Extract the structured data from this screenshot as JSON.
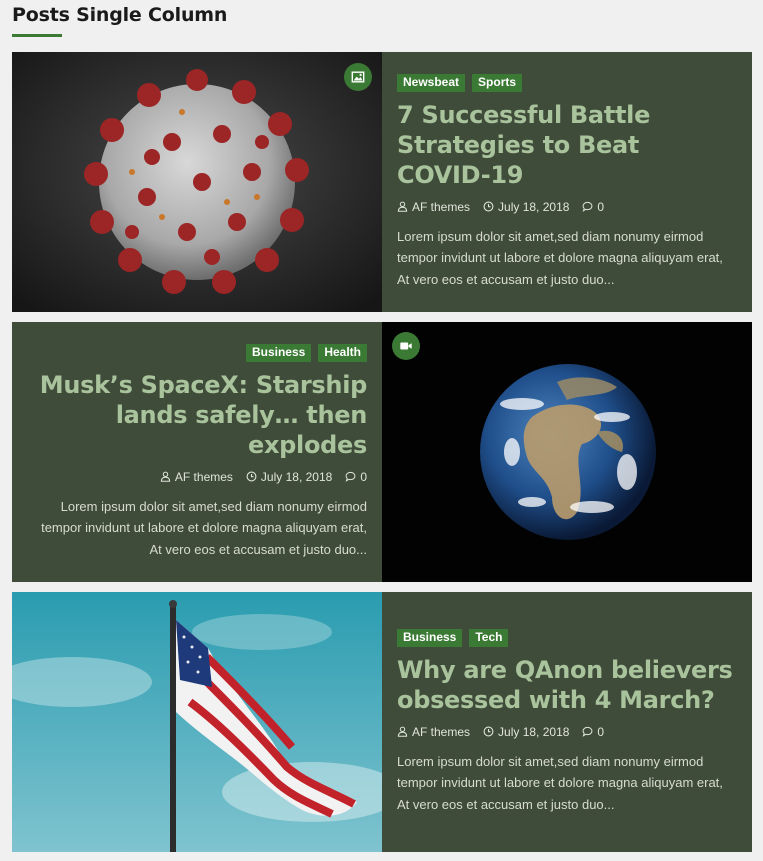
{
  "section": {
    "title": "Posts Single Column"
  },
  "posts": [
    {
      "format_icon": "image-icon",
      "categories": [
        "Newsbeat",
        "Sports"
      ],
      "title": "7 Successful Battle Strategies to Beat COVID-19",
      "author": "AF themes",
      "date": "July 18, 2018",
      "comments": "0",
      "excerpt": "Lorem ipsum dolor sit amet,sed diam nonumy eirmod tempor invidunt ut labore et dolore magna aliquyam erat, At vero eos et accusam et justo duo..."
    },
    {
      "format_icon": "video-icon",
      "categories": [
        "Business",
        "Health"
      ],
      "title": "Musk’s SpaceX: Starship lands safely… then explodes",
      "author": "AF themes",
      "date": "July 18, 2018",
      "comments": "0",
      "excerpt": "Lorem ipsum dolor sit amet,sed diam nonumy eirmod tempor invidunt ut labore et dolore magna aliquyam erat, At vero eos et accusam et justo duo..."
    },
    {
      "format_icon": "",
      "categories": [
        "Business",
        "Tech"
      ],
      "title": "Why are QAnon believers obsessed with 4 March?",
      "author": "AF themes",
      "date": "July 18, 2018",
      "comments": "0",
      "excerpt": "Lorem ipsum dolor sit amet,sed diam nonumy eirmod tempor invidunt ut labore et dolore magna aliquyam erat, At vero eos et accusam et justo duo..."
    }
  ],
  "colors": {
    "accent": "#3b7a34",
    "card_background": "#404c3a",
    "title_text": "#a9c39c"
  }
}
